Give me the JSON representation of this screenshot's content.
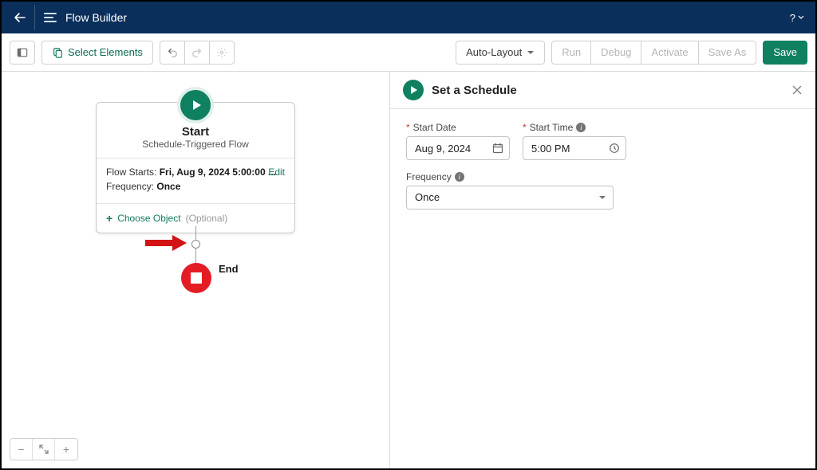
{
  "colors": {
    "header": "#0b2f5b",
    "primary": "#0f8060",
    "danger": "#e41c24"
  },
  "header": {
    "title": "Flow Builder",
    "help": "?"
  },
  "toolbar": {
    "select_elements": "Select Elements",
    "auto_layout": "Auto-Layout",
    "run": "Run",
    "debug": "Debug",
    "activate": "Activate",
    "save_as": "Save As",
    "save": "Save"
  },
  "canvas": {
    "start": {
      "title": "Start",
      "subtitle": "Schedule-Triggered Flow",
      "flow_starts_label": "Flow Starts:",
      "flow_starts_value": "Fri, Aug 9, 2024 5:00:00 ...",
      "frequency_label": "Frequency:",
      "frequency_value": "Once",
      "edit": "Edit",
      "choose_object": "Choose Object",
      "optional": "(Optional)"
    },
    "end_label": "End"
  },
  "panel": {
    "title": "Set a Schedule",
    "start_date_label": "Start Date",
    "start_date_value": "Aug 9, 2024",
    "start_time_label": "Start Time",
    "start_time_value": "5:00 PM",
    "frequency_label": "Frequency",
    "frequency_value": "Once"
  }
}
